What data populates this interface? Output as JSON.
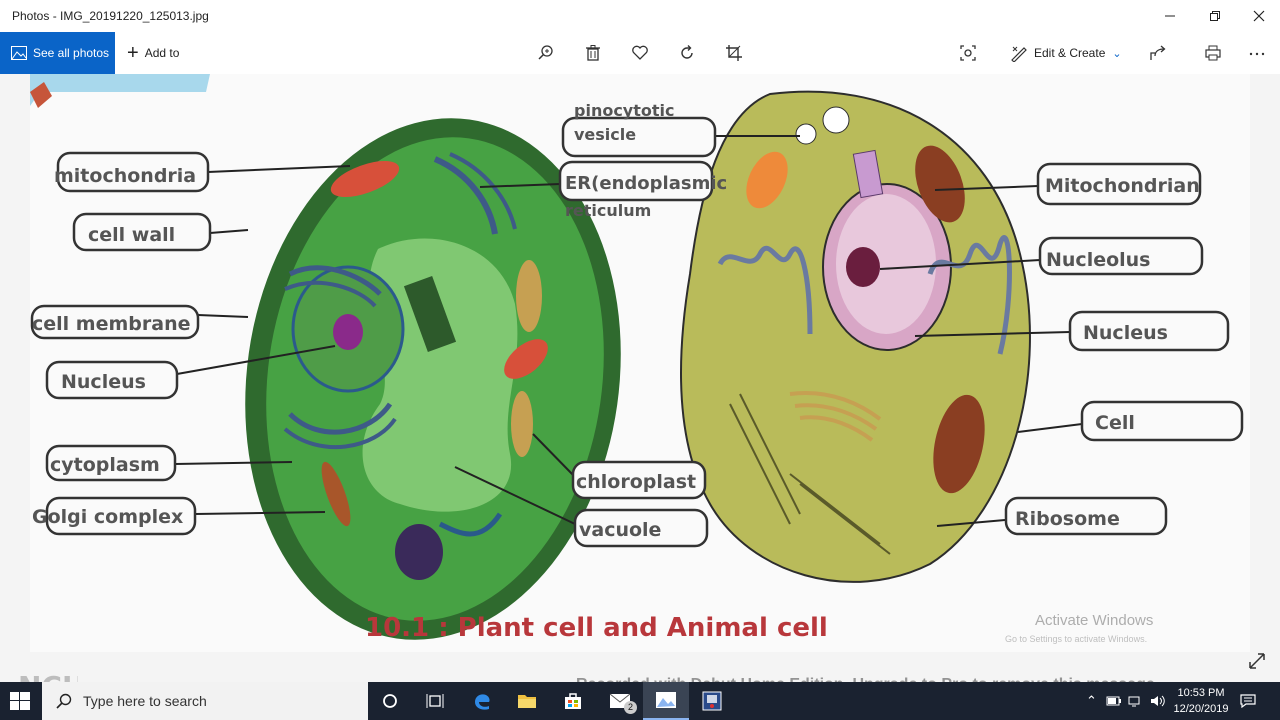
{
  "window": {
    "title": "Photos - IMG_20191220_125013.jpg",
    "minimize_icon": "minimize-icon",
    "restore_icon": "restore-icon",
    "close_icon": "close-icon"
  },
  "toolbar": {
    "see_all_label": "See all photos",
    "add_to_label": "Add to",
    "edit_create_label": "Edit & Create",
    "icons": [
      "zoom-icon",
      "delete-icon",
      "favorite-icon",
      "rotate-icon",
      "crop-icon",
      "enhance-icon",
      "share-icon",
      "print-icon",
      "more-icon"
    ]
  },
  "photo": {
    "caption": "10.1 : Plant cell and Animal cell",
    "plant_labels": {
      "mitochondria": "mitochondria",
      "cell_wall": "cell wall",
      "cell_membrane": "cell membrane",
      "nucleus": "Nucleus",
      "cytoplasm": "cytoplasm",
      "golgi": "Golgi complex",
      "pinocytotic": "pinocytotic",
      "vesicle": "vesicle",
      "er_line1": "ER(endoplasmic",
      "er_line2": "reticulum",
      "chloroplast": "chloroplast",
      "vacuole": "vacuole"
    },
    "animal_labels": {
      "mitochondrian": "Mitochondrian",
      "nucleolus": "Nucleolus",
      "nucleus": "Nucleus",
      "cell": "Cell",
      "ribosome": "Ribosome"
    }
  },
  "overlay": {
    "activate": "Activate Windows",
    "activate_sub": "Go to Settings to activate Windows.",
    "recorded": "Recorded with Debut Home Edition. Upgrade to Pro to remove this message"
  },
  "taskbar": {
    "search_placeholder": "Type here to search",
    "time": "10:53 PM",
    "date": "12/20/2019",
    "mail_badge": "2"
  },
  "colors": {
    "accent": "#0a64c8",
    "plant_cell": "#3f9a3c",
    "animal_cell": "#b9bb5a",
    "taskbar": "#1a2230"
  }
}
